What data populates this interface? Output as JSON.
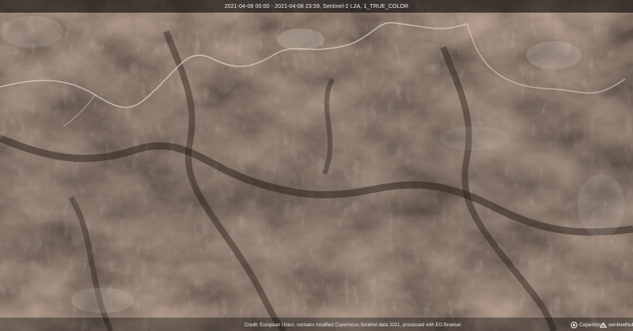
{
  "caption": {
    "text": "2021-04-08 00:00 - 2021-04-08 23:59, Sentinel-2 L2A, 1_TRUE_COLOR"
  },
  "footer": {
    "credit": "Credit: European Union, contains modified Copernicus Sentinel data 2021, processed with EO Browser",
    "copernicus_logo": "Copernicus",
    "sentinelhub_logo": "sentinelhub"
  },
  "icons": {
    "copernicus": "copernicus-logo-icon",
    "sentinelhub": "sentinelhub-logo-icon"
  },
  "colors": {
    "terrain_dark": "#3a2c23",
    "terrain_mid": "#6b5446",
    "terrain_light": "#9a8474",
    "ridge_snow": "#d8cfc4"
  }
}
